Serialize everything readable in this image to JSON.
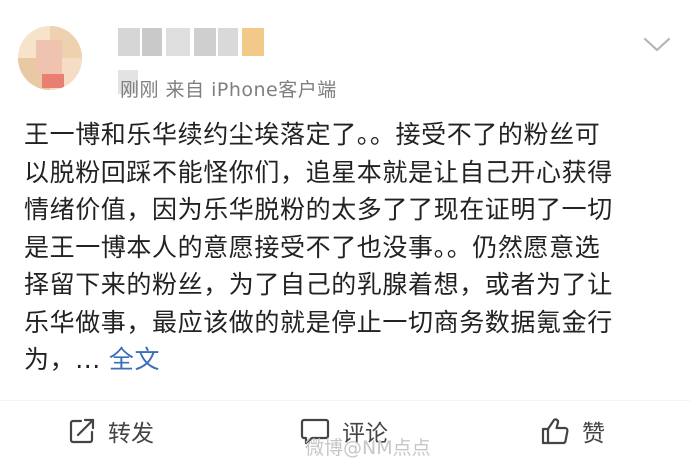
{
  "post": {
    "username": "",
    "meta_text": "刚刚  来自 iPhone客户端",
    "body_lines": [
      "王一博和乐华续约尘埃落定了。。接受不了的粉丝可",
      "以脱粉回踩不能怪你们，追星本就是让自己开心获得",
      "情绪价值，因为乐华脱粉的太多了了现在证明了一切",
      "是王一博本人的意愿接受不了也没事。。仍然愿意选",
      "择留下来的粉丝，为了自己的乳腺着想，或者为了让",
      "乐华做事，最应该做的就是停止一切商务数据氪金行",
      "为，..."
    ],
    "more_label": "全文"
  },
  "actions": {
    "repost_label": "转发",
    "comment_label": "评论",
    "like_label": "赞"
  },
  "watermark": "微博@NM点点",
  "colors": {
    "link": "#3b70b8",
    "text": "#222222",
    "meta": "#7f7f7f",
    "icon": "#444444"
  },
  "icons": {
    "menu": "chevron-down-icon",
    "repost": "share-icon",
    "comment": "comment-icon",
    "like": "thumbs-up-icon"
  }
}
